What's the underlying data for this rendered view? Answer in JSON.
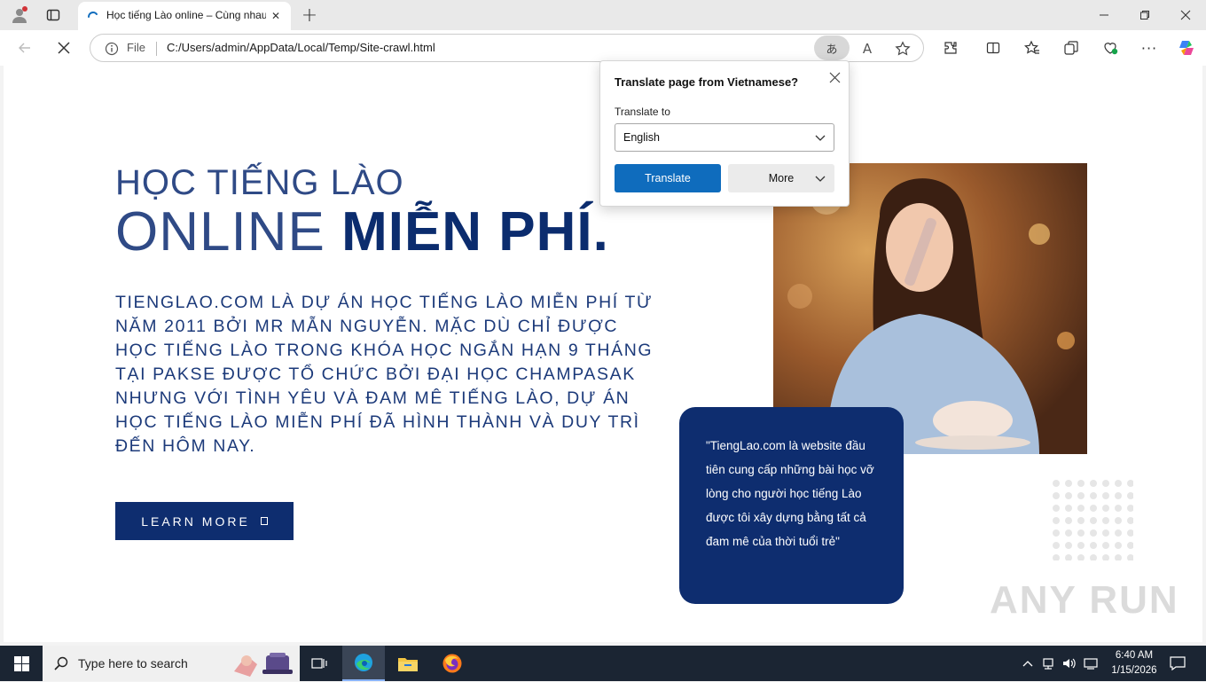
{
  "browser": {
    "tab_title": "Học tiếng Lào online – Cùng nhau",
    "new_tab_symbol": "+",
    "address_label": "File",
    "url": "C:/Users/admin/AppData/Local/Temp/Site-crawl.html",
    "translate_icon_text": "あ",
    "read_aloud_icon_text": "A",
    "window_controls": {
      "minimize": "—",
      "maximize": "▢",
      "close": "✕"
    }
  },
  "page": {
    "heading_line1": "HỌC TIẾNG LÀO",
    "heading_line2_normal": "ONLINE",
    "heading_line2_bold": "MIỄN PHÍ.",
    "description": "TiengLao.com là dự án học tiếng Lào miễn phí từ năm 2011 bởi Mr Mẫn Nguyễn. Mặc dù chỉ được học tiếng Lào trong khóa học ngắn hạn 9 tháng tại Pakse được tổ chức bởi Đại học Champasak nhưng với tình yêu và đam mê tiếng Lào, dự án học tiếng Lào miễn phí đã hình thành và duy trì đến hôm nay.",
    "learn_more_label": "LEARN MORE",
    "quote": "\"TiengLao.com là website đầu tiên cung cấp những bài học vỡ lòng cho người học tiếng Lào được tôi xây dựng bằng tất cả đam mê của thời tuổi trẻ\"",
    "watermark": "ANY RUN"
  },
  "translate_popup": {
    "title": "Translate page from Vietnamese?",
    "translate_to_label": "Translate to",
    "selected_language": "English",
    "translate_button": "Translate",
    "more_button": "More"
  },
  "taskbar": {
    "search_placeholder": "Type here to search",
    "time": "6:40 AM",
    "date": "1/15/2026"
  },
  "colors": {
    "brand_navy": "#0e2d6f",
    "heading_blue": "#2f4a86",
    "translate_blue": "#0f6cbd"
  }
}
